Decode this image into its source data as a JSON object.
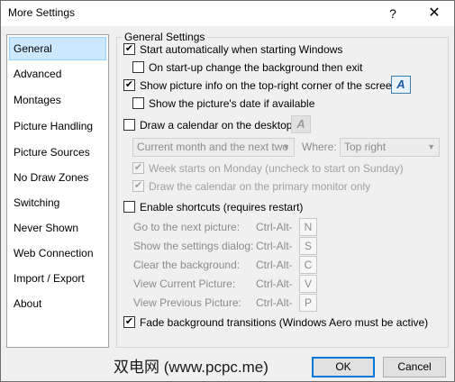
{
  "window": {
    "title": "More Settings",
    "help_glyph": "?",
    "close_glyph": "✕"
  },
  "sidebar": {
    "items": [
      {
        "label": "General",
        "selected": true
      },
      {
        "label": "Advanced"
      },
      {
        "label": "Montages"
      },
      {
        "label": "Picture Handling"
      },
      {
        "label": "Picture Sources"
      },
      {
        "label": "No Draw Zones"
      },
      {
        "label": "Switching"
      },
      {
        "label": "Never Shown"
      },
      {
        "label": "Web Connection"
      },
      {
        "label": "Import / Export"
      },
      {
        "label": "About"
      }
    ]
  },
  "general": {
    "group_title": "General Settings",
    "start_auto": {
      "label": "Start automatically when starting Windows",
      "checked": true
    },
    "startup_bg": {
      "label": "On start-up change the background then exit",
      "checked": false
    },
    "show_info": {
      "label": "Show picture info on the top-right corner of the screen",
      "checked": true
    },
    "show_date": {
      "label": "Show the picture's date if available",
      "checked": false
    },
    "calendar": {
      "label": "Draw a calendar on the desktop",
      "checked": false
    },
    "font_icon_glyph": "A",
    "calendar_range": {
      "value": "Current month and the next two"
    },
    "where_label": "Where:",
    "where_value": "Top right",
    "week_monday": {
      "label": "Week starts on Monday (uncheck to start on Sunday)",
      "checked": true
    },
    "primary_monitor": {
      "label": "Draw the calendar on the primary monitor only",
      "checked": true
    },
    "shortcuts": {
      "label": "Enable shortcuts (requires restart)",
      "checked": false
    },
    "shortcut_rows": [
      {
        "label": "Go to the next picture:",
        "mod": "Ctrl-Alt-",
        "key": "N"
      },
      {
        "label": "Show the settings dialog:",
        "mod": "Ctrl-Alt-",
        "key": "S"
      },
      {
        "label": "Clear the background:",
        "mod": "Ctrl-Alt-",
        "key": "C"
      },
      {
        "label": "View Current Picture:",
        "mod": "Ctrl-Alt-",
        "key": "V"
      },
      {
        "label": "View Previous Picture:",
        "mod": "Ctrl-Alt-",
        "key": "P"
      }
    ],
    "fade": {
      "label": "Fade background transitions (Windows Aero must be active)",
      "checked": true
    }
  },
  "footer": {
    "watermark": "双电网 (www.pcpc.me)",
    "ok_label": "OK",
    "cancel_label": "Cancel"
  },
  "check_glyph": "✔",
  "dropdown_arrow": "▼"
}
